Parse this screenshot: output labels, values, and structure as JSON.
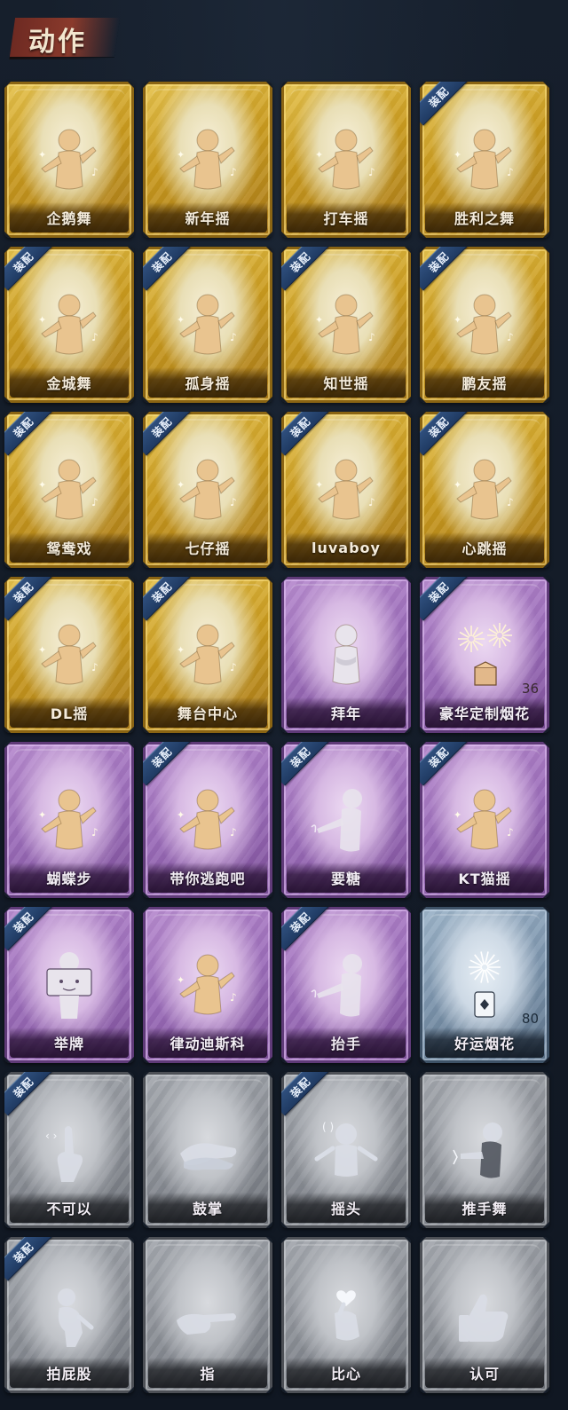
{
  "header": {
    "title": "动作"
  },
  "badge_label": "装配",
  "colors": {
    "gold": "#c99a1e",
    "purple": "#9b6cb9",
    "blue": "#7b93ab",
    "gray": "#8b8f96",
    "badge": "#2f4f7d"
  },
  "actions": [
    {
      "name": "企鹅舞",
      "rarity": "gold",
      "equipped": false,
      "icon": "dancer-icon"
    },
    {
      "name": "新年摇",
      "rarity": "gold",
      "equipped": false,
      "icon": "dancer-icon"
    },
    {
      "name": "打车摇",
      "rarity": "gold",
      "equipped": false,
      "icon": "dancer-icon"
    },
    {
      "name": "胜利之舞",
      "rarity": "gold",
      "equipped": true,
      "icon": "dancer-icon"
    },
    {
      "name": "金城舞",
      "rarity": "gold",
      "equipped": true,
      "icon": "dancer-icon"
    },
    {
      "name": "孤身摇",
      "rarity": "gold",
      "equipped": true,
      "icon": "dancer-icon"
    },
    {
      "name": "知世摇",
      "rarity": "gold",
      "equipped": true,
      "icon": "dancer-icon"
    },
    {
      "name": "鹏友摇",
      "rarity": "gold",
      "equipped": true,
      "icon": "dancer-icon"
    },
    {
      "name": "鸳鸯戏",
      "rarity": "gold",
      "equipped": true,
      "icon": "dancer-icon"
    },
    {
      "name": "七仔摇",
      "rarity": "gold",
      "equipped": true,
      "icon": "dancer-icon"
    },
    {
      "name": "luvaboy",
      "rarity": "gold",
      "equipped": true,
      "icon": "dancer-icon"
    },
    {
      "name": "心跳摇",
      "rarity": "gold",
      "equipped": true,
      "icon": "dancer-icon"
    },
    {
      "name": "DL摇",
      "rarity": "gold",
      "equipped": true,
      "icon": "dancer-icon"
    },
    {
      "name": "舞台中心",
      "rarity": "gold",
      "equipped": true,
      "icon": "dancer-icon"
    },
    {
      "name": "拜年",
      "rarity": "purple",
      "equipped": false,
      "icon": "bow-icon"
    },
    {
      "name": "豪华定制烟花",
      "rarity": "purple",
      "equipped": true,
      "icon": "fireworks-box-icon",
      "count": "36"
    },
    {
      "name": "蝴蝶步",
      "rarity": "purple",
      "equipped": false,
      "icon": "dancer-icon"
    },
    {
      "name": "带你逃跑吧",
      "rarity": "purple",
      "equipped": true,
      "icon": "dancer-icon"
    },
    {
      "name": "要糖",
      "rarity": "purple",
      "equipped": true,
      "icon": "reach-icon"
    },
    {
      "name": "KT猫摇",
      "rarity": "purple",
      "equipped": true,
      "icon": "dancer-icon"
    },
    {
      "name": "举牌",
      "rarity": "purple",
      "equipped": true,
      "icon": "sign-icon"
    },
    {
      "name": "律动迪斯科",
      "rarity": "purple",
      "equipped": false,
      "icon": "dancer-icon"
    },
    {
      "name": "抬手",
      "rarity": "purple",
      "equipped": true,
      "icon": "reach-icon"
    },
    {
      "name": "好运烟花",
      "rarity": "blue",
      "equipped": false,
      "icon": "fireworks-can-icon",
      "count": "80"
    },
    {
      "name": "不可以",
      "rarity": "gray",
      "equipped": true,
      "icon": "finger-icon"
    },
    {
      "name": "鼓掌",
      "rarity": "gray",
      "equipped": false,
      "icon": "clap-icon"
    },
    {
      "name": "摇头",
      "rarity": "gray",
      "equipped": true,
      "icon": "shake-head-icon"
    },
    {
      "name": "推手舞",
      "rarity": "gray",
      "equipped": false,
      "icon": "push-hand-icon"
    },
    {
      "name": "拍屁股",
      "rarity": "gray",
      "equipped": true,
      "icon": "spank-icon"
    },
    {
      "name": "指",
      "rarity": "gray",
      "equipped": false,
      "icon": "point-icon"
    },
    {
      "name": "比心",
      "rarity": "gray",
      "equipped": false,
      "icon": "heart-hand-icon"
    },
    {
      "name": "认可",
      "rarity": "gray",
      "equipped": false,
      "icon": "thumbs-up-icon"
    }
  ]
}
